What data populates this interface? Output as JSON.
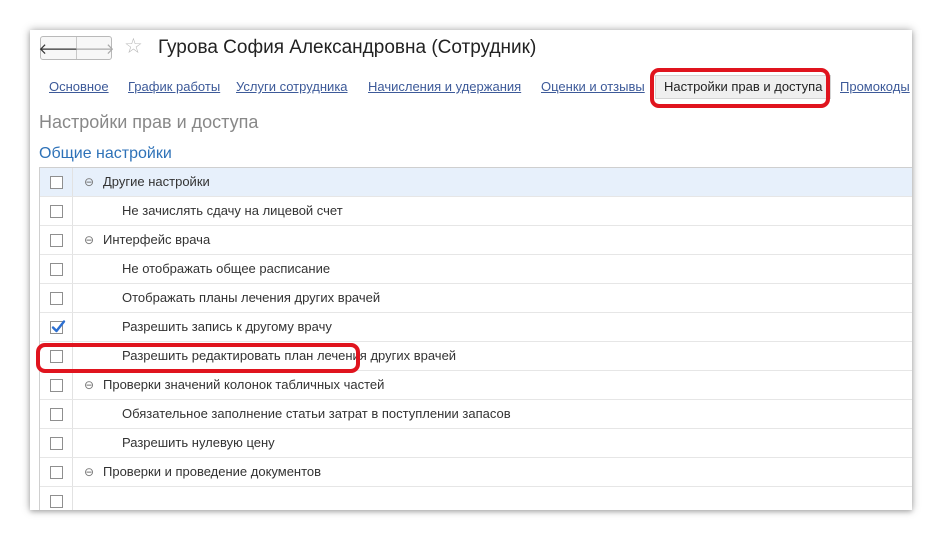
{
  "header": {
    "back_icon": "arrow-left-icon",
    "forward_icon": "arrow-right-icon",
    "back_glyph": "🡐",
    "forward_glyph": "🡒",
    "star_icon": "star-icon",
    "star_glyph": "☆",
    "title": "Гурова София Александровна (Сотрудник)"
  },
  "tabs": [
    {
      "label": "Основное"
    },
    {
      "label": "График работы"
    },
    {
      "label": "Услуги сотрудника"
    },
    {
      "label": "Начисления и удержания"
    },
    {
      "label": "Оценки и отзывы"
    },
    {
      "label": "Настройки прав и доступа",
      "active": true
    },
    {
      "label": "Промокоды"
    }
  ],
  "page_heading": "Настройки прав и доступа",
  "section_heading": "Общие настройки",
  "tree": {
    "collapse_glyph": "⊖",
    "rows": [
      {
        "label": "Другие настройки",
        "level": "group",
        "checked": false
      },
      {
        "label": "Не зачислять сдачу на лицевой счет",
        "level": "child",
        "checked": false
      },
      {
        "label": "Интерфейс врача",
        "level": "group",
        "checked": false
      },
      {
        "label": "Не отображать общее расписание",
        "level": "child",
        "checked": false
      },
      {
        "label": "Отображать планы лечения других врачей",
        "level": "child",
        "checked": false
      },
      {
        "label": "Разрешить запись к другому врачу",
        "level": "child",
        "checked": true
      },
      {
        "label": "Разрешить редактировать план лечения других врачей",
        "level": "child",
        "checked": false
      },
      {
        "label": "Проверки значений колонок табличных частей",
        "level": "group",
        "checked": false
      },
      {
        "label": "Обязательное заполнение статьи затрат в поступлении запасов",
        "level": "child",
        "checked": false
      },
      {
        "label": "Разрешить нулевую цену",
        "level": "child",
        "checked": false
      },
      {
        "label": "Проверки и проведение документов",
        "level": "group",
        "checked": false
      }
    ]
  },
  "colors": {
    "highlight": "#e0141e",
    "link": "#3d5a99",
    "section_heading": "#2e72b8",
    "checkmark": "#2c6fd1"
  }
}
